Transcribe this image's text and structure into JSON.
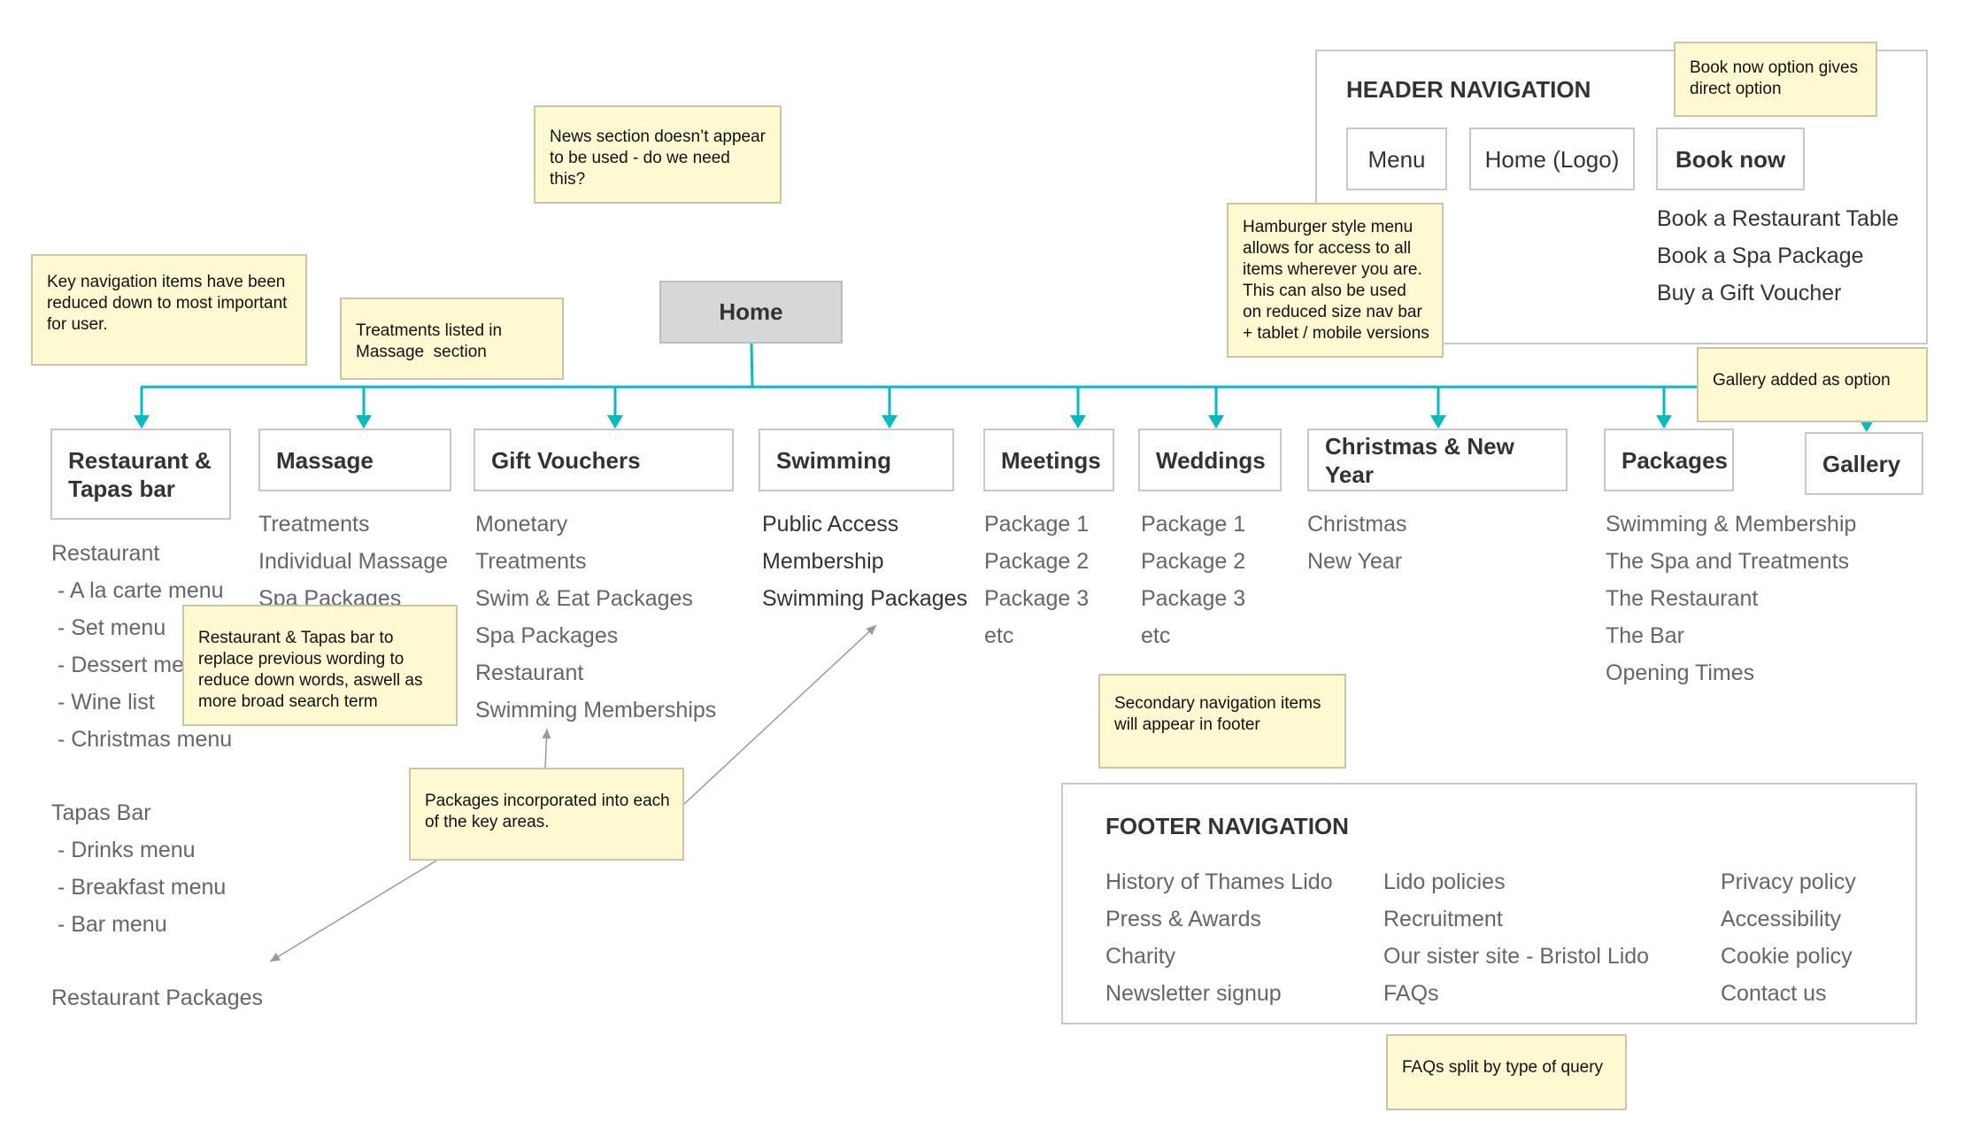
{
  "home": {
    "label": "Home"
  },
  "header_nav": {
    "title": "HEADER NAVIGATION",
    "buttons": [
      "Menu",
      "Home (Logo)",
      "Book now"
    ],
    "book_options": [
      "Book a Restaurant Table",
      "Book a Spa Package",
      "Buy a Gift Voucher"
    ]
  },
  "nav_items": [
    {
      "label_lines": [
        "Restaurant &",
        "Tapas bar"
      ],
      "items": []
    },
    {
      "label": "Massage",
      "items": [
        "Treatments",
        "Individual Massage",
        "Spa Packages"
      ]
    },
    {
      "label": "Gift Vouchers",
      "items": [
        "Monetary",
        "Treatments",
        "Swim & Eat Packages",
        "Spa Packages",
        "Restaurant",
        "Swimming Memberships"
      ]
    },
    {
      "label": "Swimming",
      "items": [
        "Public Access",
        "Membership",
        "Swimming Packages"
      ]
    },
    {
      "label": "Meetings",
      "items": [
        "Package 1",
        "Package 2",
        "Package 3",
        "etc"
      ]
    },
    {
      "label": "Weddings",
      "items": [
        "Package 1",
        "Package 2",
        "Package 3",
        "etc"
      ]
    },
    {
      "label": "Christmas & New Year",
      "items": [
        "Christmas",
        "New Year"
      ]
    },
    {
      "label": "Packages",
      "items": [
        "Swimming & Membership",
        "The Spa and Treatments",
        "The Restaurant",
        "The Bar",
        "Opening Times"
      ]
    },
    {
      "label": "Gallery",
      "items": []
    }
  ],
  "restaurant_list": {
    "restaurant_heading": "Restaurant",
    "restaurant_items": [
      " - A la carte menu",
      " - Set menu",
      " - Dessert menu",
      " - Wine list",
      " - Christmas menu"
    ],
    "tapas_heading": "Tapas Bar",
    "tapas_items": [
      " - Drinks menu",
      " - Breakfast menu",
      " - Bar menu"
    ],
    "packages": "Restaurant Packages"
  },
  "footer_nav": {
    "title": "FOOTER NAVIGATION",
    "columns": [
      [
        "History of Thames Lido",
        "Press & Awards",
        "Charity",
        "Newsletter signup"
      ],
      [
        "Lido policies",
        "Recruitment",
        "Our sister site - Bristol Lido",
        "FAQs"
      ],
      [
        "Privacy policy",
        "Accessibility",
        "Cookie policy",
        "Contact us"
      ]
    ]
  },
  "notes": {
    "key_nav": "Key navigation items have been reduced down to most important for user.",
    "treatments": "Treatments listed in Massage  section",
    "news": "News section doesn’t appear to be used - do we need this?",
    "hamburger": "Hamburger style menu allows for access to all items wherever you are. This can also be used on reduced size nav bar + tablet / mobile versions",
    "book_now": "Book now option gives direct option",
    "gallery": "Gallery added as option",
    "restaurant_tapas": "Restaurant & Tapas bar to replace previous wording to reduce down words, aswell as more broad search term",
    "packages": "Packages incorporated into each of the key areas.",
    "secondary": "Secondary navigation items will appear in footer",
    "faqs": "FAQs split by type of query"
  },
  "colors": {
    "connector": "#00bdc4",
    "note_bg": "#fff9d2",
    "home_bg": "#d7d7d7",
    "annotation_arrow": "#9a9a9a"
  }
}
